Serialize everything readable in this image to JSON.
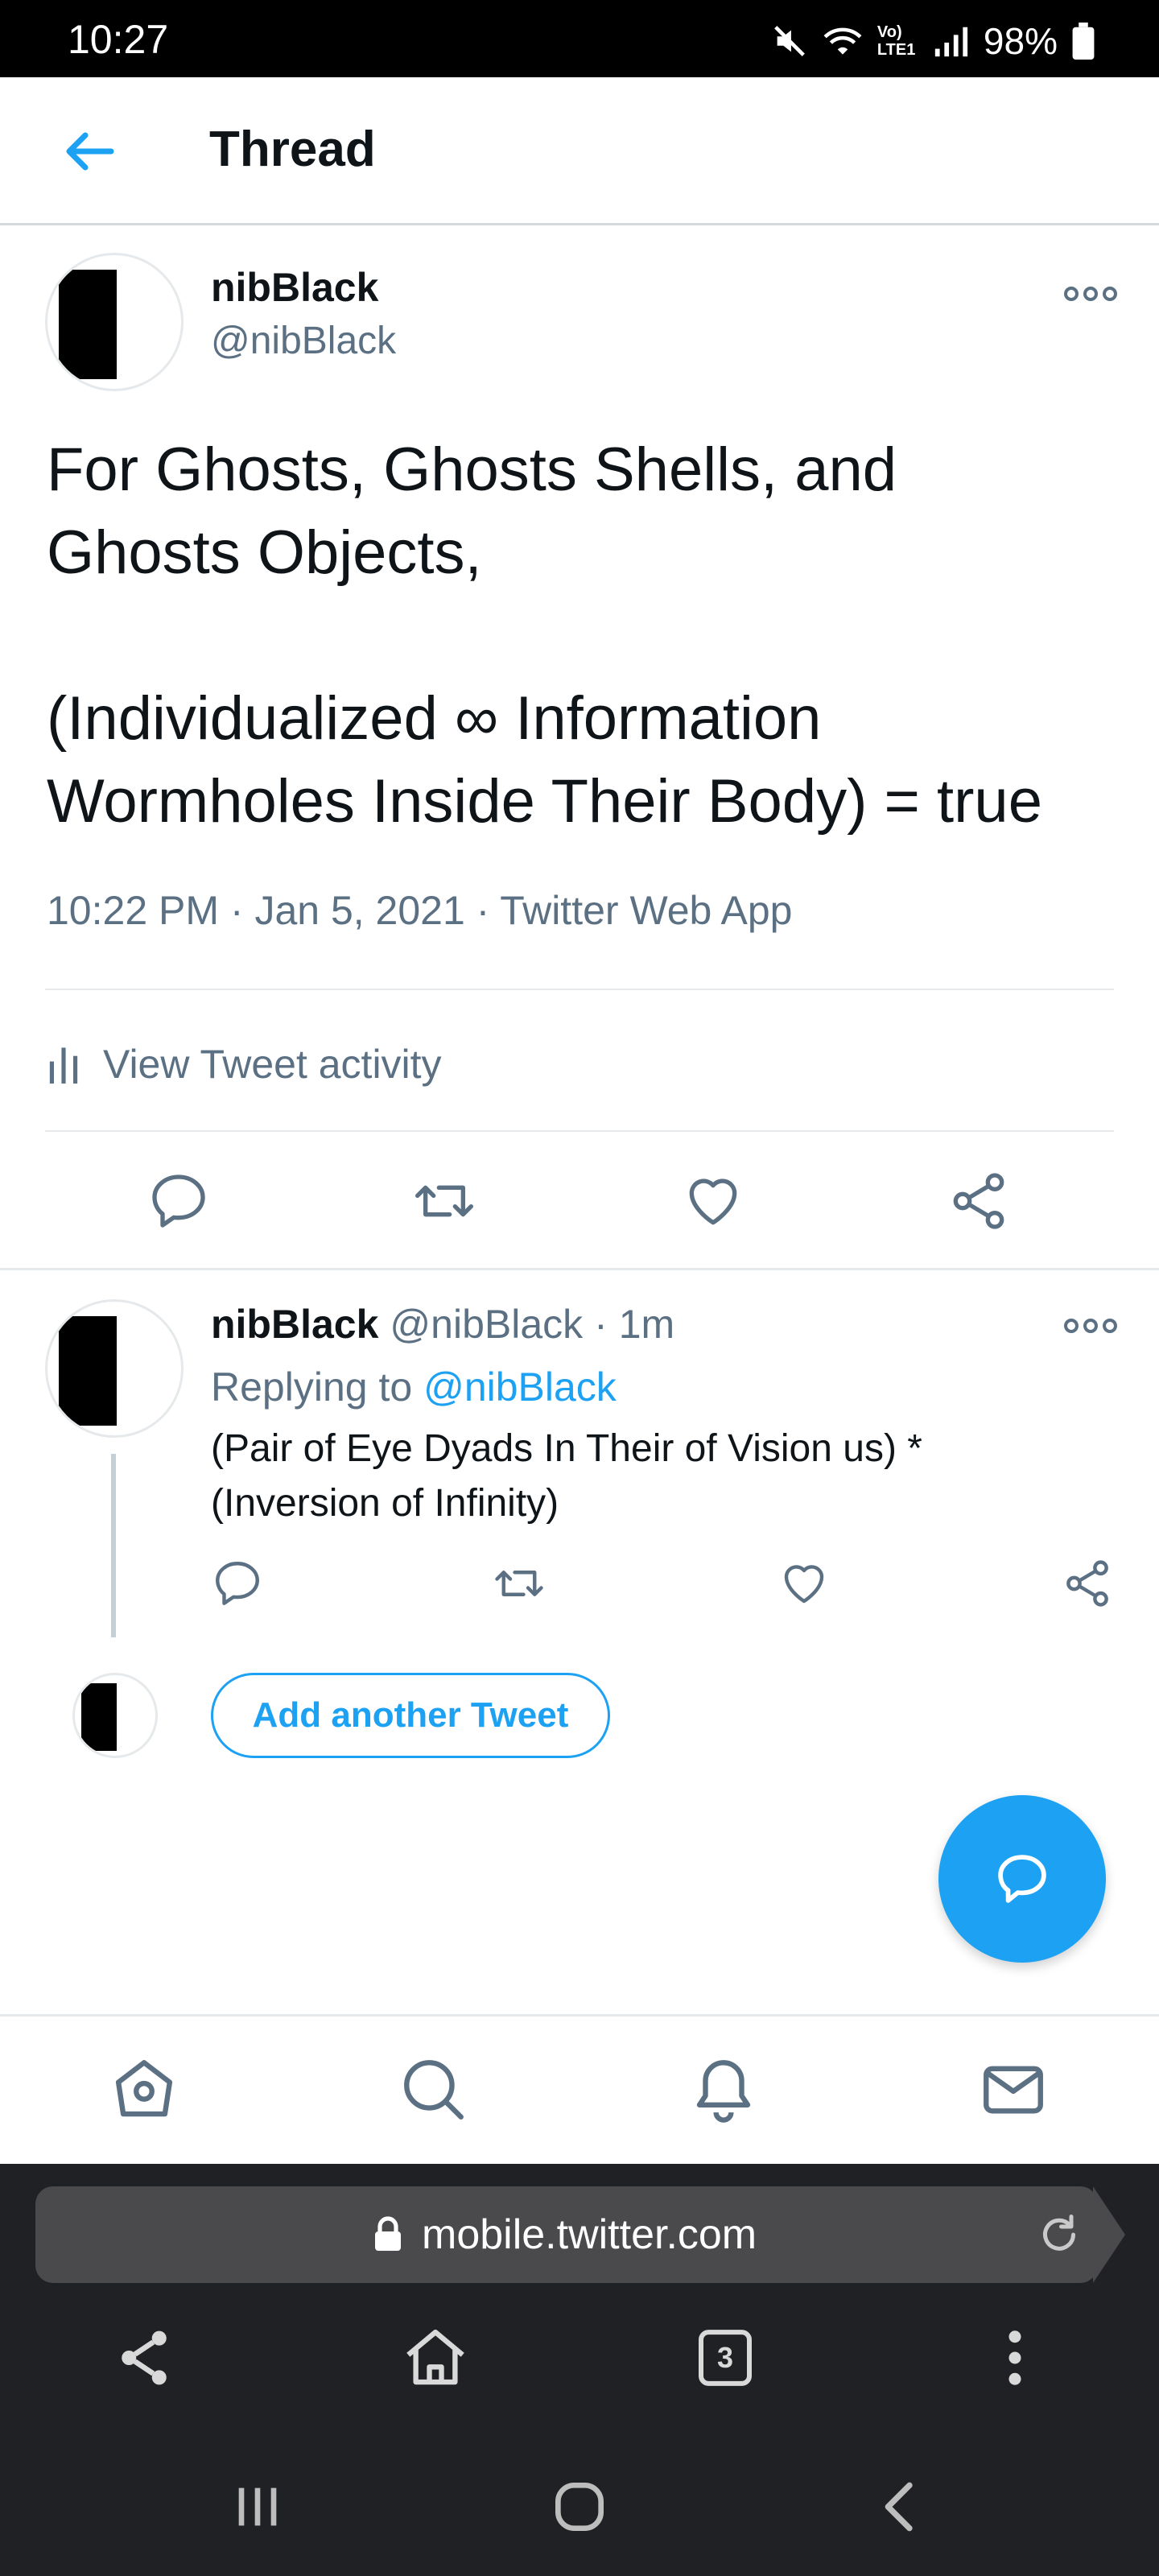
{
  "status_bar": {
    "time": "10:27",
    "battery": "98%",
    "network_label": "Vo) LTE1"
  },
  "header": {
    "title": "Thread"
  },
  "main_tweet": {
    "name": "nibBlack",
    "handle": "@nibBlack",
    "text": "For Ghosts, Ghosts Shells, and\nGhosts Objects,\n\n(Individualized ∞ Information\nWormholes Inside Their Body) = true",
    "time": "10:22 PM",
    "date": "Jan 5, 2021",
    "source": "Twitter Web App",
    "meta": "10:22 PM · Jan 5, 2021 · Twitter Web App",
    "activity_label": "View Tweet activity"
  },
  "reply": {
    "name": "nibBlack",
    "handle": "@nibBlack",
    "age": "· 1m",
    "replying_label": "Replying to",
    "replying_to": "@nibBlack",
    "text": "(Pair of Eye Dyads In Their of Vision us) * (Inversion of Infinity)"
  },
  "compose": {
    "add_label": "Add another Tweet"
  },
  "browser": {
    "url": "mobile.twitter.com",
    "tab_count": "3"
  },
  "colors": {
    "accent": "#1da1f2",
    "secondary_text": "#5b7083",
    "browser_bg": "#202124"
  },
  "icons": [
    "back-arrow-icon",
    "more-icon",
    "reply-icon",
    "retweet-icon",
    "like-icon",
    "share-icon",
    "compose-icon",
    "home-icon",
    "search-icon",
    "notifications-icon",
    "messages-icon",
    "lock-icon",
    "reload-icon",
    "tabs-icon"
  ]
}
